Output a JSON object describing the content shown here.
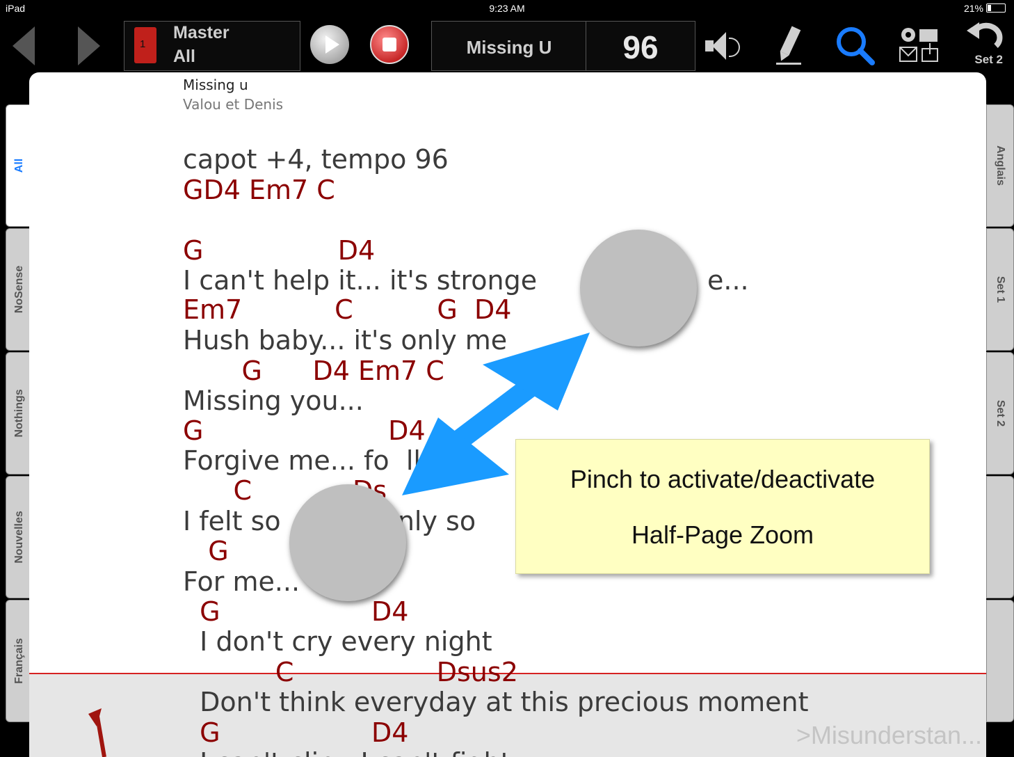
{
  "status_bar": {
    "device": "iPad",
    "time": "9:23 AM",
    "battery": "21%"
  },
  "toolbar": {
    "book_number": "1",
    "book_title": "Master",
    "book_subtitle": "All",
    "song_title": "Missing U",
    "tempo": "96",
    "undo_label": "Set 2"
  },
  "left_tabs": [
    "All",
    "NoSense",
    "Nothings",
    "Nouvelles",
    "Français"
  ],
  "right_tabs": [
    "Anglais",
    "Set 1",
    "Set 2"
  ],
  "song": {
    "title": "Missing u",
    "artist": "Valou et Denis",
    "lines": [
      {
        "kind": "lyric",
        "text": "capot +4, tempo 96"
      },
      {
        "kind": "chord",
        "text": "GD4 Em7 C"
      },
      {
        "kind": "chord",
        "text": "G                D4"
      },
      {
        "kind": "lyric",
        "text": "I can't help it... it's stronge"
      },
      {
        "kind": "lyric",
        "text": "e..."
      },
      {
        "kind": "chord",
        "text": "Em7           C          G  D4"
      },
      {
        "kind": "lyric",
        "text": "Hush baby... it's only me"
      },
      {
        "kind": "chord",
        "text": "       G      D4 Em7 C"
      },
      {
        "kind": "lyric",
        "text": "Missing you..."
      },
      {
        "kind": "chord",
        "text": "G                      D4"
      },
      {
        "kind": "lyric",
        "text": "Forgive me... fo  lling"
      },
      {
        "kind": "chord",
        "text": "      C            Ds"
      },
      {
        "kind": "lyric",
        "text": "I felt so            only so"
      },
      {
        "kind": "chord",
        "text": "   G               7 C"
      },
      {
        "kind": "lyric",
        "text": "For me..."
      },
      {
        "kind": "chord",
        "text": "  G                  D4"
      },
      {
        "kind": "lyric",
        "text": "  I don't cry every night"
      },
      {
        "kind": "chord",
        "text": "           C                 Dsus2"
      },
      {
        "kind": "lyric",
        "text": "  Don't think everyday at this precious moment"
      },
      {
        "kind": "chord",
        "text": "  G                  D4"
      },
      {
        "kind": "lyric",
        "text": "  I can't clip   I can't fight"
      }
    ],
    "next_song_hint": ">Misunderstan..."
  },
  "callout": {
    "line1": "Pinch to activate/deactivate",
    "line2": "Half-Page Zoom"
  },
  "colors": {
    "chord": "#8b0000",
    "lyric": "#3b3b3b",
    "zoom_line": "#d62222",
    "accent": "#1a7cff",
    "callout_bg": "#ffffc2"
  }
}
